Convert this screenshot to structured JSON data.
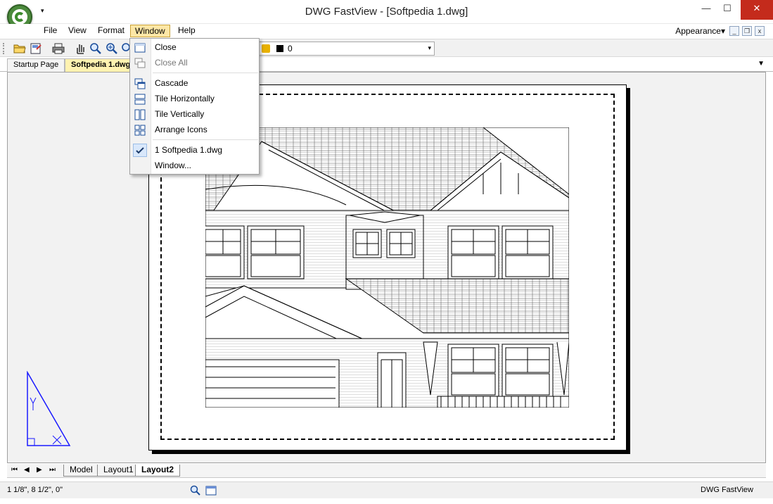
{
  "window": {
    "title": "DWG FastView - [Softpedia 1.dwg]",
    "qa_arrow": "▾",
    "minimize_glyph": "—",
    "maximize_glyph": "☐",
    "close_glyph": "✕"
  },
  "menu": {
    "items": [
      {
        "label": "File"
      },
      {
        "label": "View"
      },
      {
        "label": "Format"
      },
      {
        "label": "Window"
      },
      {
        "label": "Help"
      }
    ],
    "appearance_label": "Appearance▾",
    "mdi_min": "_",
    "mdi_restore": "❐",
    "mdi_close": "x"
  },
  "toolbar": {
    "layer_value": "0",
    "layer_color": "#000000",
    "dropdown_glyph": "▾"
  },
  "tabs": {
    "items": [
      {
        "label": "Startup Page"
      },
      {
        "label": "Softpedia 1.dwg"
      }
    ],
    "dropdown_glyph": "▼"
  },
  "window_menu": {
    "items": [
      {
        "label": "Close",
        "icon": "window-icon"
      },
      {
        "label": "Close All",
        "icon": "windows-icon"
      },
      {
        "label": "Cascade",
        "icon": "cascade-icon"
      },
      {
        "label": "Tile Horizontally",
        "icon": "tile-horizontal-icon"
      },
      {
        "label": "Tile Vertically",
        "icon": "tile-vertical-icon"
      },
      {
        "label": "Arrange Icons",
        "icon": "arrange-icons-icon"
      },
      {
        "label": "1 Softpedia 1.dwg",
        "icon": "check-icon"
      },
      {
        "label": "Window..."
      }
    ]
  },
  "layouts": {
    "nav": [
      "⏮",
      "◀",
      "▶",
      "⏭"
    ],
    "tabs": [
      {
        "label": "Model"
      },
      {
        "label": "Layout1"
      },
      {
        "label": "Layout2"
      }
    ]
  },
  "status": {
    "coordinates": "1 1/8\", 8 1/2\", 0\"",
    "app_name": "DWG FastView"
  },
  "colors": {
    "menu_highlight": "#fde7a6",
    "active_tab": "#fff2b0",
    "close_button": "#c42b1c",
    "check_highlight": "#d9e8fb",
    "ucs_blue": "#1a1aff"
  }
}
